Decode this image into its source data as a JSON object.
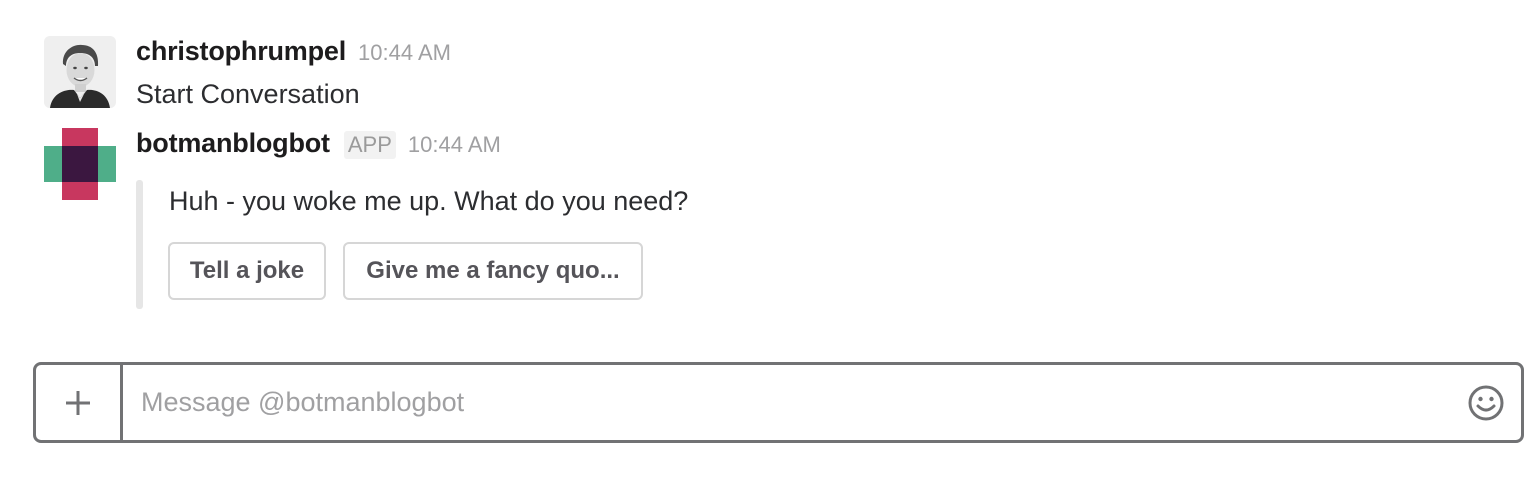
{
  "messages": [
    {
      "sender": "christophrumpel",
      "time": "10:44 AM",
      "text": "Start Conversation",
      "avatar_icon": "user-avatar"
    },
    {
      "sender": "botmanblogbot",
      "badge": "APP",
      "time": "10:44 AM",
      "avatar_icon": "bot-avatar",
      "attachment": {
        "text": "Huh - you woke me up. What do you need?",
        "actions": [
          {
            "label": "Tell a joke"
          },
          {
            "label": "Give me a fancy quo..."
          }
        ]
      }
    }
  ],
  "composer": {
    "placeholder": "Message @botmanblogbot",
    "value": "",
    "plus_icon": "plus-icon",
    "emoji_icon": "emoji-icon"
  },
  "colors": {
    "bot_pink": "#c8375f",
    "bot_green": "#4fae89",
    "bot_dark": "#3b1740",
    "composer_border": "#717274",
    "attachment_bar": "#e6e6e6"
  }
}
